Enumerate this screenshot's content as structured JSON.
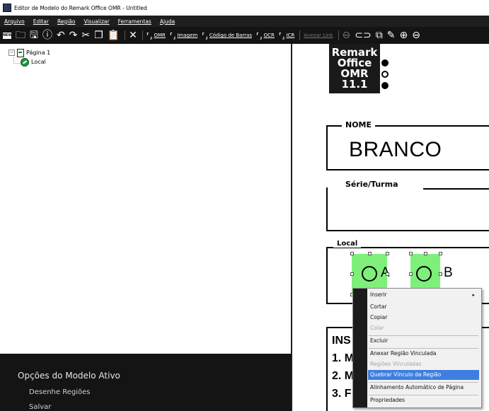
{
  "window": {
    "title": "Editor de Modelo do Remark Office OMR - Untitled"
  },
  "menu": [
    "Arquivo",
    "Editar",
    "Região",
    "Visualizar",
    "Ferramentas",
    "Ajuda"
  ],
  "toolbar": {
    "icons": [
      "new-icon",
      "open-folder-icon",
      "save-icon",
      "info-icon",
      "undo-icon",
      "redo-icon",
      "cut-icon",
      "copy-icon",
      "paste-icon",
      "delete-icon"
    ],
    "region_buttons": [
      "OMR",
      "Imagem",
      "Código de Barras",
      "OCR",
      "ICR"
    ],
    "attach_link": "Anexar Link",
    "right_icons": [
      "link-icon",
      "unlink-icon",
      "auto-align-icon",
      "pencil-icon",
      "zoom-in-icon",
      "zoom-out-icon"
    ]
  },
  "tree": {
    "page": "Página 1",
    "region": "Local"
  },
  "options": {
    "title": "Opções do Modelo Ativo",
    "items": [
      "Desenhe Regiões",
      "Salvar"
    ]
  },
  "document": {
    "logo_lines": [
      "Remark",
      "Office OMR",
      "11.1"
    ],
    "nome_label": "NOME",
    "nome_value": "BRANCO",
    "serie_label": "Série/Turma",
    "local_label": "Local",
    "option_a": "A",
    "option_b": "B",
    "ins_lines": [
      "INS",
      "1. M",
      "2. M",
      "3. F"
    ]
  },
  "context_menu": {
    "items": [
      {
        "label": "Inserir",
        "enabled": true,
        "submenu": true
      },
      {
        "label": "Cortar",
        "enabled": true
      },
      {
        "label": "Copiar",
        "enabled": true
      },
      {
        "label": "Colar",
        "enabled": false
      },
      {
        "label": "Excluir",
        "enabled": true
      },
      {
        "label": "Anexar Região Vinculada",
        "enabled": true
      },
      {
        "label": "Regiões Vinculadas",
        "enabled": false
      },
      {
        "label": "Quebrar Vínculo da Região",
        "enabled": true,
        "selected": true
      },
      {
        "label": "Alinhamento Automático de Página",
        "enabled": true
      },
      {
        "label": "Propriedades",
        "enabled": true
      }
    ]
  },
  "colors": {
    "region_fill": "#7ef07a",
    "menu_highlight": "#3e7ee0",
    "dark_bar": "#141414"
  }
}
